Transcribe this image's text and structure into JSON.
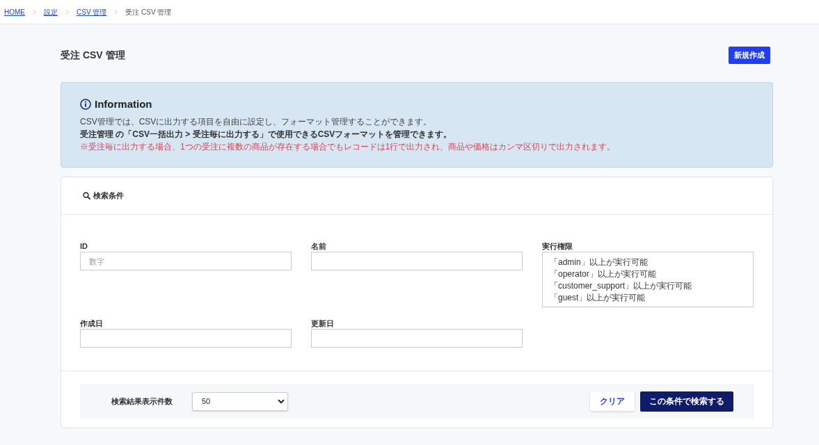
{
  "breadcrumb": [
    {
      "label": "HOME",
      "link": true
    },
    {
      "label": "設定",
      "link": true
    },
    {
      "label": "CSV 管理",
      "link": true
    },
    {
      "label": "受注 CSV 管理",
      "link": false
    }
  ],
  "page": {
    "title": "受注 CSV 管理",
    "new_button": "新規作成"
  },
  "information": {
    "title": "Information",
    "lines": [
      {
        "kind": "normal",
        "text": "CSV管理では、CSVに出力する項目を自由に設定し、フォーマット管理することができます。"
      },
      {
        "kind": "bold",
        "text": "受注管理 の「CSV一括出力 > 受注毎に出力する」で使用できるCSVフォーマットを管理できます。"
      },
      {
        "kind": "warning",
        "text": "※受注毎に出力する場合、1つの受注に複数の商品が存在する場合でもレコードは1行で出力され、商品や価格はカンマ区切りで出力されます。"
      }
    ]
  },
  "search": {
    "title": "検索条件",
    "fields": [
      {
        "kind": "text",
        "label": "ID",
        "placeholder": "数字"
      },
      {
        "kind": "text",
        "label": "名前"
      },
      {
        "kind": "listbox",
        "label": "実行権限",
        "options": [
          {
            "label": "「admin」以上が実行可能",
            "selected": false
          },
          {
            "label": "「operator」以上が実行可能",
            "selected": false
          },
          {
            "label": "「customer_support」以上が実行可能",
            "selected": false
          },
          {
            "label": "「guest」以上が実行可能",
            "selected": false
          }
        ]
      },
      {
        "kind": "text",
        "label": "作成日"
      },
      {
        "kind": "text",
        "label": "更新日"
      }
    ],
    "page_size": {
      "label": "検索結果表示件数",
      "value": "50"
    },
    "buttons": [
      {
        "kind": "secondary",
        "label": "クリア"
      },
      {
        "kind": "primary",
        "label": "この条件で検索する"
      }
    ]
  }
}
